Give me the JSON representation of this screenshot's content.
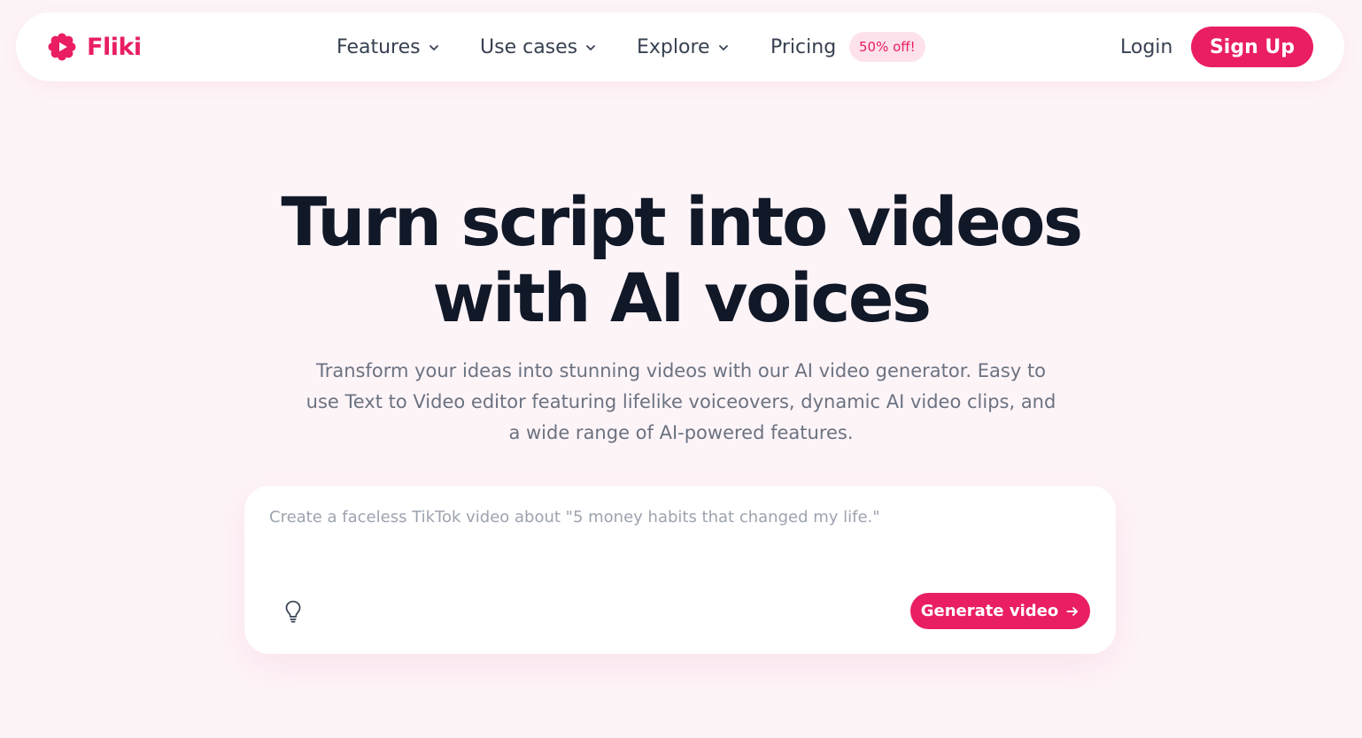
{
  "brand": {
    "name": "Fliki",
    "accent_color": "#e91e63",
    "logo_icon": "flower-play-icon"
  },
  "nav": {
    "items": [
      {
        "label": "Features",
        "icon": "chevron-down-icon"
      },
      {
        "label": "Use cases",
        "icon": "chevron-down-icon"
      },
      {
        "label": "Explore",
        "icon": "chevron-down-icon"
      },
      {
        "label": "Pricing"
      }
    ],
    "promo_badge": "50% off!",
    "login_label": "Login",
    "signup_label": "Sign Up"
  },
  "hero": {
    "title_line1": "Turn script into videos",
    "title_line2": "with AI voices",
    "subtitle": "Transform your ideas into stunning videos with our AI video generator. Easy to use Text to Video editor featuring lifelike voiceovers, dynamic AI video clips, and a wide range of AI-powered features."
  },
  "prompt": {
    "placeholder": "Create a faceless TikTok video about \"5 money habits that changed my life.\"",
    "value": "",
    "idea_icon": "lightbulb-icon",
    "generate_label": "Generate video",
    "generate_icon": "arrow-right-icon"
  }
}
